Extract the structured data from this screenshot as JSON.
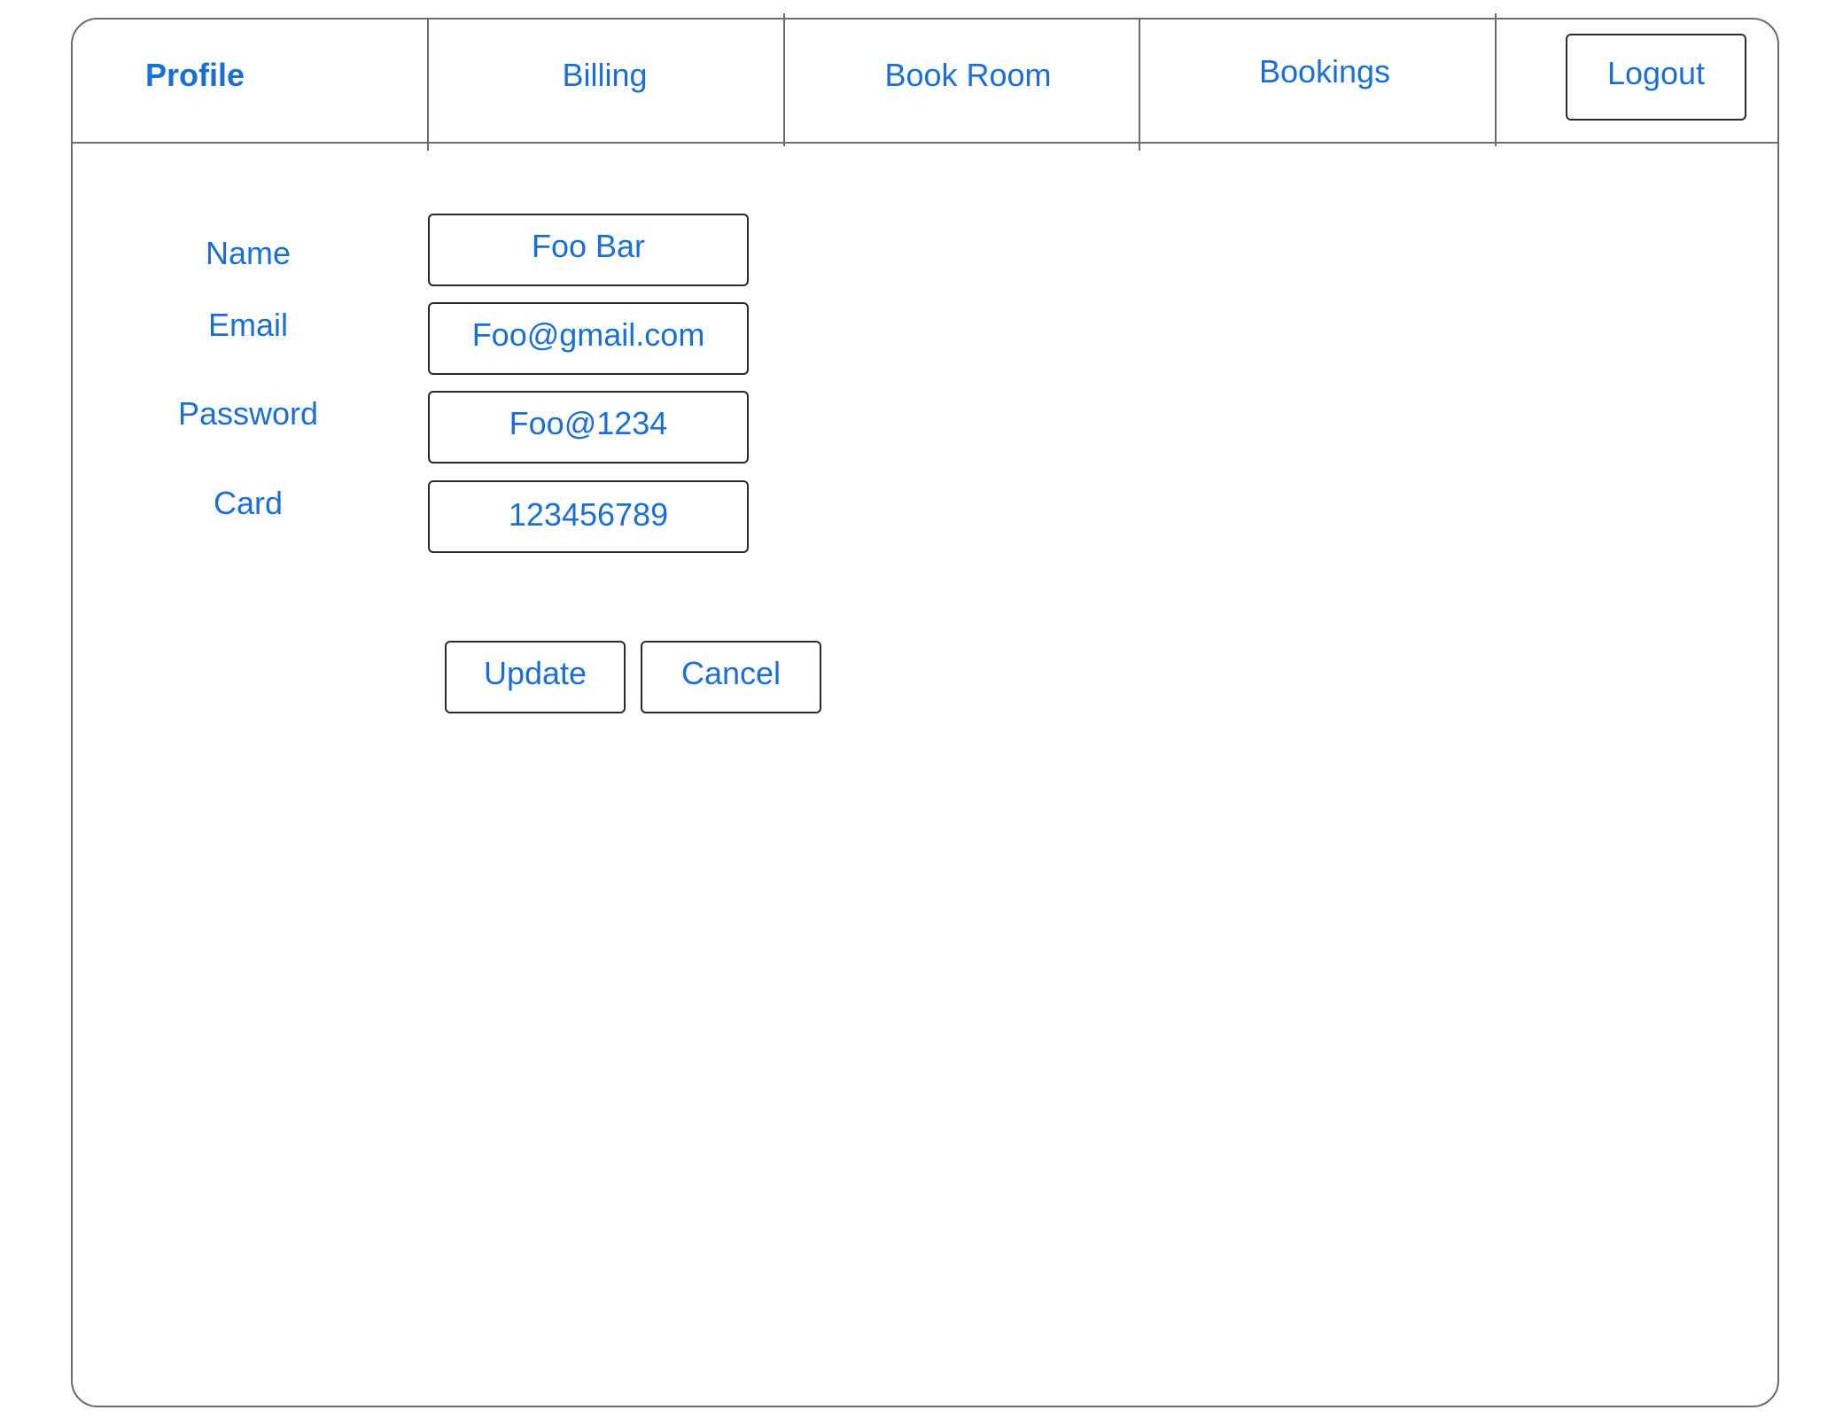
{
  "nav": {
    "tabs": [
      {
        "label": "Profile",
        "active": true
      },
      {
        "label": "Billing",
        "active": false
      },
      {
        "label": "Book Room",
        "active": false
      },
      {
        "label": "Bookings",
        "active": false
      }
    ],
    "logout_label": "Logout"
  },
  "form": {
    "fields": [
      {
        "label": "Name",
        "value": "Foo Bar"
      },
      {
        "label": "Email",
        "value": "Foo@gmail.com"
      },
      {
        "label": "Password",
        "value": "Foo@1234"
      },
      {
        "label": "Card",
        "value": "123456789"
      }
    ],
    "update_label": "Update",
    "cancel_label": "Cancel"
  },
  "colors": {
    "text": "#1a6fd6",
    "border": "#2a2a2a",
    "frame": "#6b6b6b"
  }
}
